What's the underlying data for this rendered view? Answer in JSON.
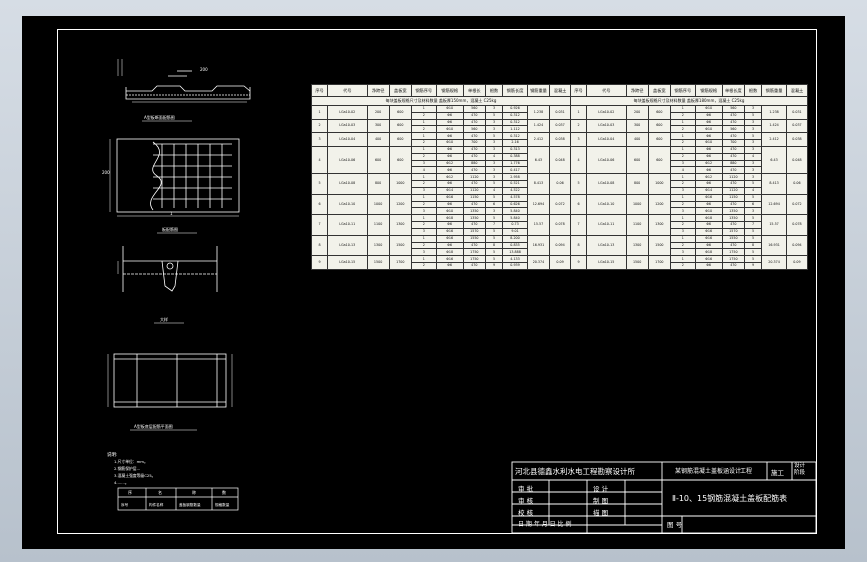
{
  "drawing": {
    "views": {
      "section_label": "A型板断面配筋图",
      "plan_label": "板配筋图",
      "detail_label": "大样",
      "bottom_label": "A型板底层配筋平面图"
    },
    "dims": {
      "width_top": "200",
      "side": "200",
      "mark": "1"
    },
    "notes": {
      "heading": "说明:",
      "lines": [
        "1.尺寸单位：mm。",
        "2.钢筋保护层...",
        "3.混凝土强度等级C25。",
        "4.......。"
      ]
    },
    "legend": {
      "headers": [
        "序",
        "名",
        "称",
        "数"
      ],
      "row": [
        "序号",
        "构件名称",
        "盖板钢筋数量",
        "规格数量"
      ]
    }
  },
  "table": {
    "left_headers": [
      "序号",
      "代号",
      "净跨径",
      "盖板宽",
      "钢筋序号",
      "钢筋规格",
      "单根长",
      "根数",
      "钢筋长度",
      "钢筋重量",
      "混凝土"
    ],
    "right_headers": [
      "序号",
      "代号",
      "净跨径",
      "盖板宽",
      "钢筋序号",
      "钢筋规格",
      "单根长度",
      "根数",
      "钢筋重量",
      "混凝土"
    ],
    "left_note": "每块盖板规格尺寸及材料数量 盖板厚150mm，混凝土 C25kg",
    "right_note": "每块盖板规格尺寸及材料数量 盖板厚180mm，混凝土 C25kg",
    "rows": [
      {
        "no": "1",
        "code": "LGa10-02",
        "span": "200",
        "width": "600",
        "w1": "1.238",
        "c1": "0.031",
        "w2": "1.238",
        "c2": "0.031",
        "sub": [
          [
            "1",
            "Φ10",
            "560",
            "3",
            "0.926"
          ],
          [
            "2",
            "Φ6",
            "470",
            "5",
            "0.312"
          ]
        ]
      },
      {
        "no": "2",
        "code": "LGa10-03",
        "span": "300",
        "width": "600",
        "w1": "1.424",
        "c1": "0.037",
        "w2": "1.424",
        "c2": "0.037",
        "sub": [
          [
            "1",
            "Φ6",
            "470",
            "3",
            "0.312"
          ],
          [
            "2",
            "Φ10",
            "560",
            "3",
            "1.112"
          ]
        ]
      },
      {
        "no": "3",
        "code": "LGa10-04",
        "width": "600",
        "span": "400",
        "w1": "2.412",
        "c1": "0.038",
        "w2": "2.412",
        "c2": "0.038",
        "sub": [
          [
            "1",
            "Φ6",
            "470",
            "5",
            "0.312"
          ],
          [
            "2",
            "Φ10",
            "700",
            "3",
            "2.16"
          ]
        ]
      },
      {
        "no": "4",
        "code": "LGa10-06",
        "span": "600",
        "width": "600",
        "w1": "6.43",
        "c1": "0.048",
        "w2": "6.43",
        "c2": "0.048",
        "sub": [
          [
            "1",
            "Φ6",
            "470",
            "3",
            "0.313"
          ],
          [
            "2",
            "Φ6",
            "470",
            "4",
            "0.388"
          ],
          [
            "3",
            "Φ12",
            "880",
            "3",
            "1.776"
          ],
          [
            "4",
            "Φ6",
            "470",
            "3",
            "0.417"
          ]
        ]
      },
      {
        "no": "5",
        "code": "LGa10-08",
        "span": "800",
        "width": "1000",
        "w1": "8.413",
        "c1": "0.06",
        "w2": "8.413",
        "c2": "0.06",
        "sub": [
          [
            "1",
            "Φ12",
            "1120",
            "3",
            "2.958"
          ],
          [
            "2",
            "Φ6",
            "470",
            "5",
            "0.521"
          ],
          [
            "3",
            "Φ14",
            "1120",
            "4",
            "4.522"
          ]
        ]
      },
      {
        "no": "6",
        "code": "LGa10-10",
        "span": "1000",
        "width": "1200",
        "w1": "12.694",
        "c1": "0.072",
        "w2": "12.694",
        "c2": "0.072",
        "sub": [
          [
            "1",
            "Φ16",
            "1150",
            "5",
            "4.578"
          ],
          [
            "2",
            "Φ6",
            "470",
            "6",
            "0.626"
          ],
          [
            "3",
            "Φ10",
            "1350",
            "3",
            "5.840"
          ]
        ]
      },
      {
        "no": "7",
        "code": "LGa10-11",
        "span": "1100",
        "width": "1300",
        "w1": "15.57",
        "c1": "0.078",
        "w2": "15.57",
        "c2": "0.078",
        "sub": [
          [
            "1",
            "Φ18",
            "1350",
            "5",
            "5.840"
          ],
          [
            "2",
            "Φ6",
            "470",
            "7",
            "0.73"
          ],
          [
            "3",
            "Φ16",
            "1570",
            "5",
            "9.01"
          ]
        ]
      },
      {
        "no": "8",
        "code": "LGa10-13",
        "span": "1300",
        "width": "1500",
        "w1": "16.931",
        "c1": "0.094",
        "w2": "16.931",
        "c2": "0.094",
        "sub": [
          [
            "1",
            "Φ16",
            "1550",
            "5",
            "8.200"
          ],
          [
            "2",
            "Φ6",
            "470",
            "8",
            "0.835"
          ],
          [
            "3",
            "Φ18",
            "1750",
            "5",
            "13.888"
          ]
        ]
      },
      {
        "no": "9",
        "code": "LGa10-15",
        "span": "1500",
        "width": "1700",
        "w1": "20.374",
        "c1": "0.09",
        "w2": "20.374",
        "c2": "0.09",
        "sub": [
          [
            "1",
            "Φ16",
            "1750",
            "5",
            "4.133"
          ],
          [
            "2",
            "Φ6",
            "470",
            "9",
            "0.939"
          ]
        ]
      }
    ]
  },
  "titleblock": {
    "company": "河北县德鑫水利水电工程勘察设计所",
    "project": "某钢筋混凝土盖板涵设计",
    "project_suffix": "工程",
    "stage_label": "施工",
    "stage_value": "设计\n阶段",
    "title": "Ⅱ-10、15钢筋混凝土盖板配筋表",
    "rows_left": [
      "审 批",
      "审 核",
      "校 核"
    ],
    "rows_mid": [
      "设 计",
      "制 图",
      "描 图"
    ],
    "date_row": "日 期  年 月 日 比 例",
    "sheet_label": "图 号"
  }
}
